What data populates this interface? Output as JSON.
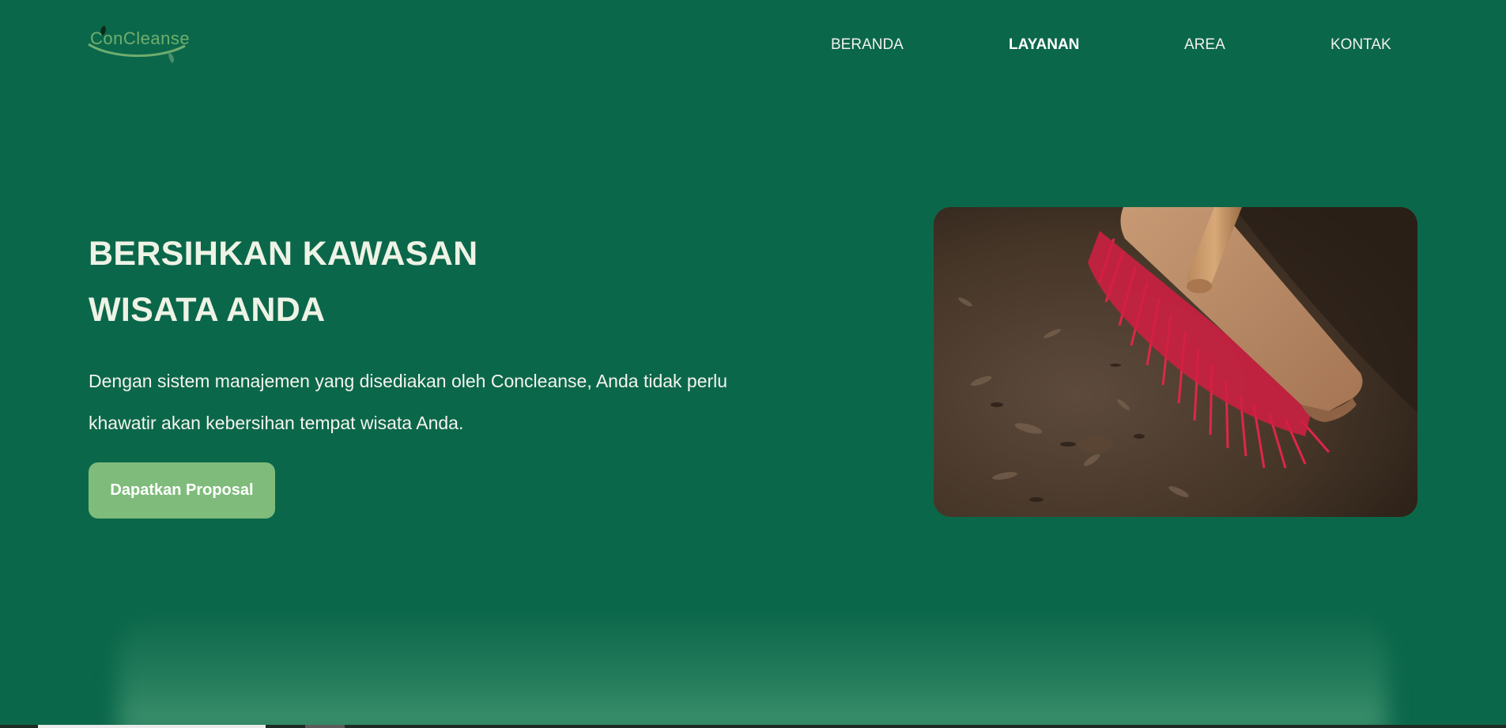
{
  "brand": {
    "logo_text": "ConCleanse",
    "logo_icon": "leaf-icon"
  },
  "nav": {
    "items": [
      {
        "label": "BERANDA",
        "active": false
      },
      {
        "label": "LAYANAN",
        "active": true
      },
      {
        "label": "AREA",
        "active": false
      },
      {
        "label": "KONTAK",
        "active": false
      }
    ]
  },
  "hero": {
    "title_line1": "BERSIHKAN KAWASAN",
    "title_line2": "WISATA ANDA",
    "desc_line1": "Dengan sistem manajemen yang disediakan oleh Concleanse, Anda tidak perlu",
    "desc_line2": "khawatir akan kebersihan tempat wisata Anda.",
    "cta_label": "Dapatkan Proposal",
    "image_alt": "broom-photo"
  },
  "colors": {
    "background": "#0b674a",
    "accent": "#7fbb7b",
    "title": "#eef3e6"
  }
}
